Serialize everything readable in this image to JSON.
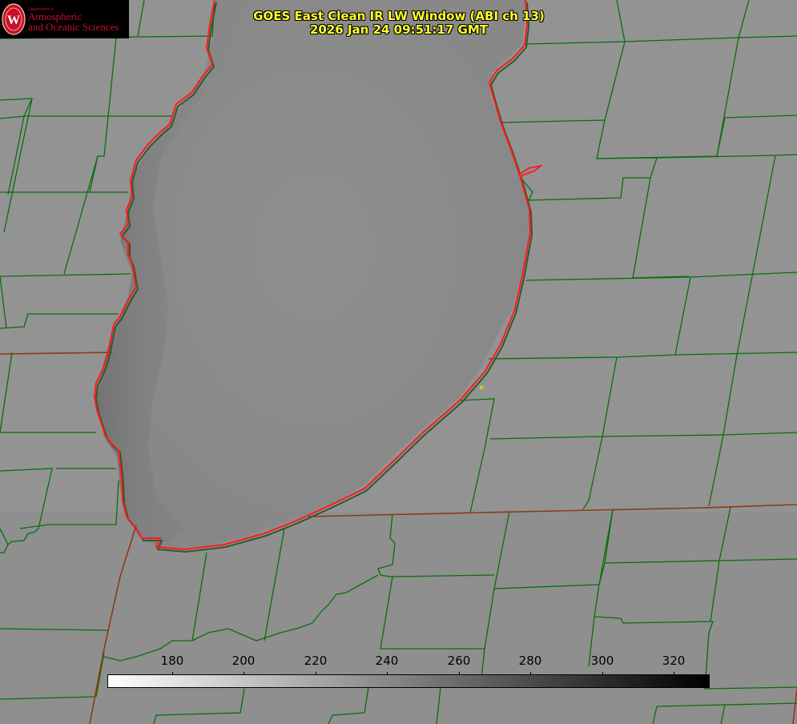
{
  "header": {
    "title_line1": "GOES East Clean IR LW Window (ABI ch 13)",
    "title_line2": "2026 Jan 24 09:51:17 GMT"
  },
  "logo": {
    "dept_line": "Department of",
    "line1": "Atmospheric",
    "line2": "and Oceanic Sciences",
    "seal_letter": "W"
  },
  "colorbar": {
    "ticks": [
      "180",
      "200",
      "220",
      "240",
      "260",
      "280",
      "300",
      "320"
    ],
    "gradient": [
      "#ffffff",
      "#000000"
    ]
  },
  "colors": {
    "county_lines": "#0a6e0a",
    "state_lines": "#8a3a14",
    "coastline": "#ff1a1a",
    "title_text": "#ffff2a",
    "logo_red": "#c8102e"
  }
}
